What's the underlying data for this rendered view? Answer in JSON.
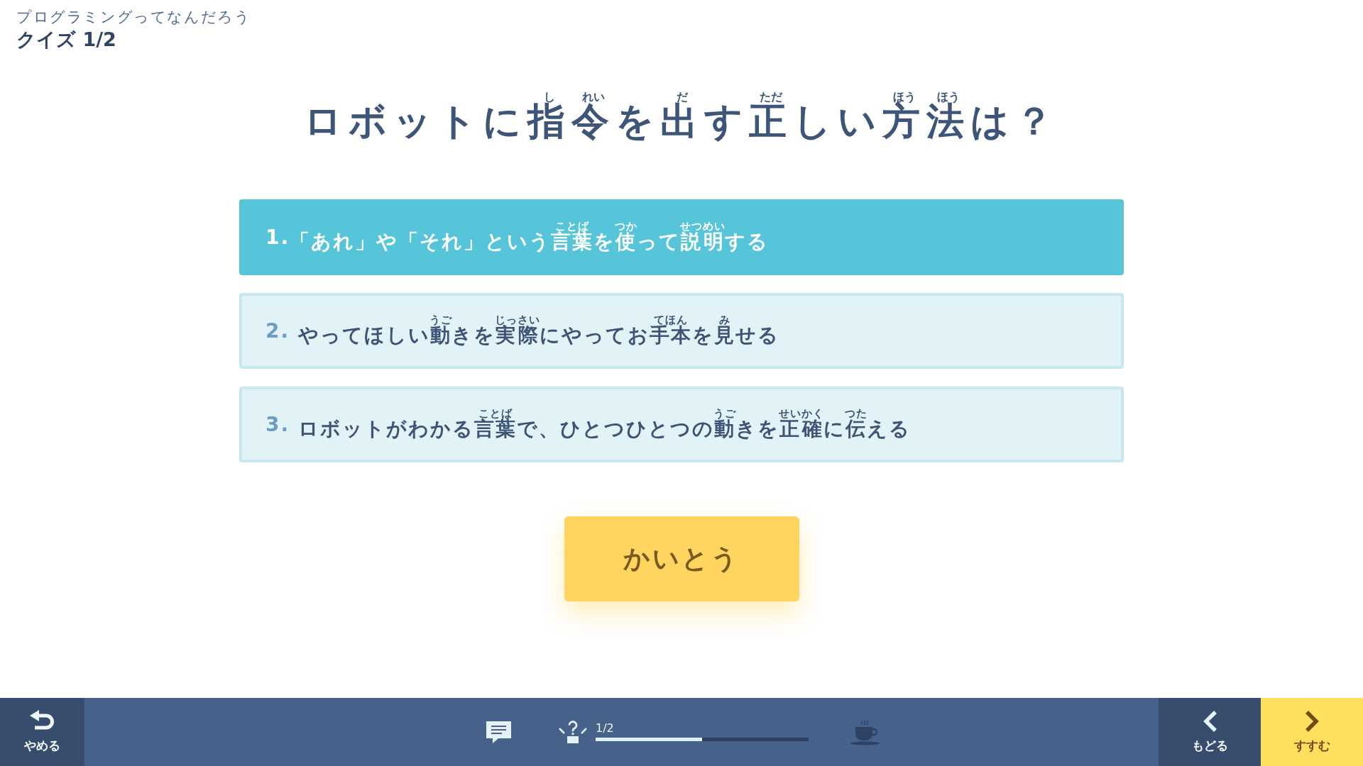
{
  "header": {
    "subtitle": "プログラミングってなんだろう",
    "title": "クイズ 1/2"
  },
  "question": {
    "segments": [
      {
        "text": "ロボットに"
      },
      {
        "text": "指",
        "ruby": "し"
      },
      {
        "text": "令",
        "ruby": "れい"
      },
      {
        "text": "を"
      },
      {
        "text": "出",
        "ruby": "だ"
      },
      {
        "text": "す"
      },
      {
        "text": "正",
        "ruby": "ただ"
      },
      {
        "text": "しい"
      },
      {
        "text": "方",
        "ruby": "ほう"
      },
      {
        "text": "法",
        "ruby": "ほう"
      },
      {
        "text": "は？"
      }
    ]
  },
  "options": [
    {
      "number": "1.",
      "selected": true,
      "segments": [
        {
          "text": "「あれ」や「それ」という"
        },
        {
          "text": "言葉",
          "ruby": "ことば"
        },
        {
          "text": "を"
        },
        {
          "text": "使",
          "ruby": "つか"
        },
        {
          "text": "って"
        },
        {
          "text": "説明",
          "ruby": "せつめい"
        },
        {
          "text": "する"
        }
      ]
    },
    {
      "number": "2.",
      "selected": false,
      "segments": [
        {
          "text": "やってほしい"
        },
        {
          "text": "動",
          "ruby": "うご"
        },
        {
          "text": "きを"
        },
        {
          "text": "実際",
          "ruby": "じっさい"
        },
        {
          "text": "にやってお"
        },
        {
          "text": "手本",
          "ruby": "てほん"
        },
        {
          "text": "を"
        },
        {
          "text": "見",
          "ruby": "み"
        },
        {
          "text": "せる"
        }
      ]
    },
    {
      "number": "3.",
      "selected": false,
      "segments": [
        {
          "text": "ロボットがわかる"
        },
        {
          "text": "言葉",
          "ruby": "ことば"
        },
        {
          "text": "で、ひとつひとつの"
        },
        {
          "text": "動",
          "ruby": "うご"
        },
        {
          "text": "きを"
        },
        {
          "text": "正確",
          "ruby": "せいかく"
        },
        {
          "text": "に"
        },
        {
          "text": "伝",
          "ruby": "つた"
        },
        {
          "text": "える"
        }
      ]
    }
  ],
  "answer_button": {
    "label": "かいとう"
  },
  "bottom_bar": {
    "quit_button": {
      "label": "やめる"
    },
    "progress": {
      "label": "1/2",
      "level": 0.5
    },
    "nav_buttons": [
      {
        "kind": "back",
        "label": "もどる"
      },
      {
        "kind": "next",
        "label": "すすむ"
      }
    ]
  }
}
